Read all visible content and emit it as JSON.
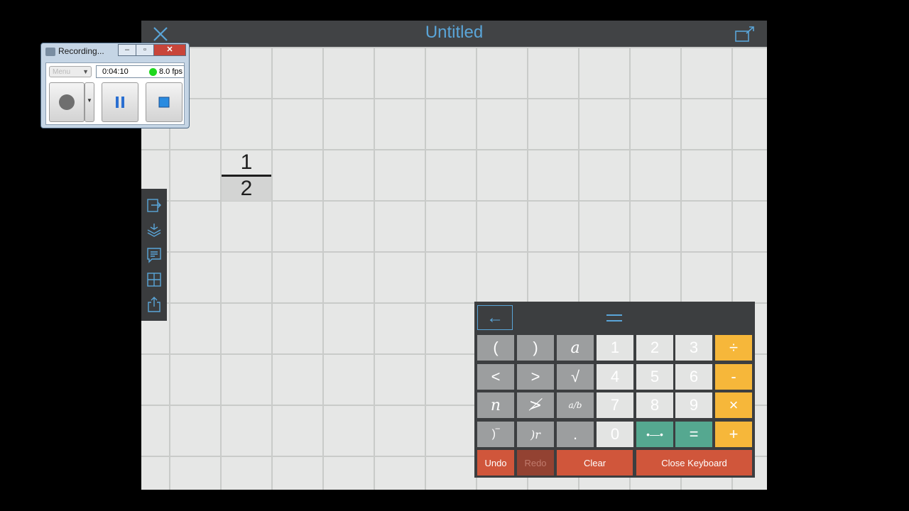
{
  "app": {
    "title": "Untitled",
    "close_icon": "close-icon",
    "expand_icon": "expand-icon"
  },
  "canvas": {
    "fraction": {
      "numerator": "1",
      "denominator": "2"
    }
  },
  "palette": {
    "items": [
      "import-icon",
      "layers-icon",
      "notes-icon",
      "grid-icon",
      "share-icon"
    ]
  },
  "keyboard": {
    "back_label": "←",
    "rows": [
      [
        "(",
        ")",
        "a",
        "1",
        "2",
        "3",
        "÷"
      ],
      [
        "<",
        ">",
        "√",
        "4",
        "5",
        "6",
        "-"
      ],
      [
        "n",
        "≯",
        "a/b",
        "7",
        "8",
        "9",
        "×"
      ],
      [
        ")‾",
        ")r",
        ".",
        "0",
        "•—•",
        "=",
        "+"
      ]
    ],
    "undo": "Undo",
    "redo": "Redo",
    "clear": "Clear",
    "close": "Close Keyboard"
  },
  "recorder": {
    "title": "Recording...",
    "menu": "Menu",
    "time": "0:04:10",
    "fps": "8.0 fps",
    "status_color": "#1ed81e"
  },
  "colors": {
    "accent": "#5aa5d8",
    "orange": "#f6b73a",
    "teal": "#55a890",
    "red": "#d0563b"
  }
}
